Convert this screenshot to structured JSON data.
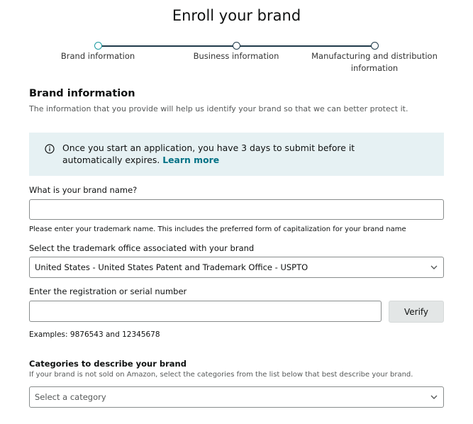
{
  "page": {
    "title": "Enroll your brand"
  },
  "stepper": {
    "steps": [
      {
        "label": "Brand information"
      },
      {
        "label": "Business information"
      },
      {
        "label_line1": "Manufacturing and distribution",
        "label_line2": "information"
      }
    ],
    "active_step": 1
  },
  "brand_section": {
    "title": "Brand information",
    "description": "The information that you provide will help us identify your brand so that we can better protect it."
  },
  "alert": {
    "icon": "info-icon",
    "text": "Once you start an application, you have 3 days to submit before it automatically expires.",
    "link": "Learn more"
  },
  "brand_name": {
    "label": "What is your brand name?",
    "value": "",
    "hint": "Please enter your trademark name. This includes the preferred form of capitalization for your brand name"
  },
  "trademark_office": {
    "label": "Select the trademark office associated with your brand",
    "selected": "United States - United States Patent and Trademark Office - USPTO"
  },
  "registration": {
    "label": "Enter the registration or serial number",
    "value": "",
    "verify_label": "Verify",
    "examples": "Examples: 9876543 and 12345678"
  },
  "categories": {
    "title": "Categories to describe your brand",
    "description": "If your brand is not sold on Amazon, select the categories from the list below that best describe your brand.",
    "placeholder": "Select a category"
  },
  "colors": {
    "accent": "#1a9aa0",
    "link": "#007185",
    "alert_bg": "#e6f1f3",
    "stepper_line": "#1f3a4a"
  }
}
